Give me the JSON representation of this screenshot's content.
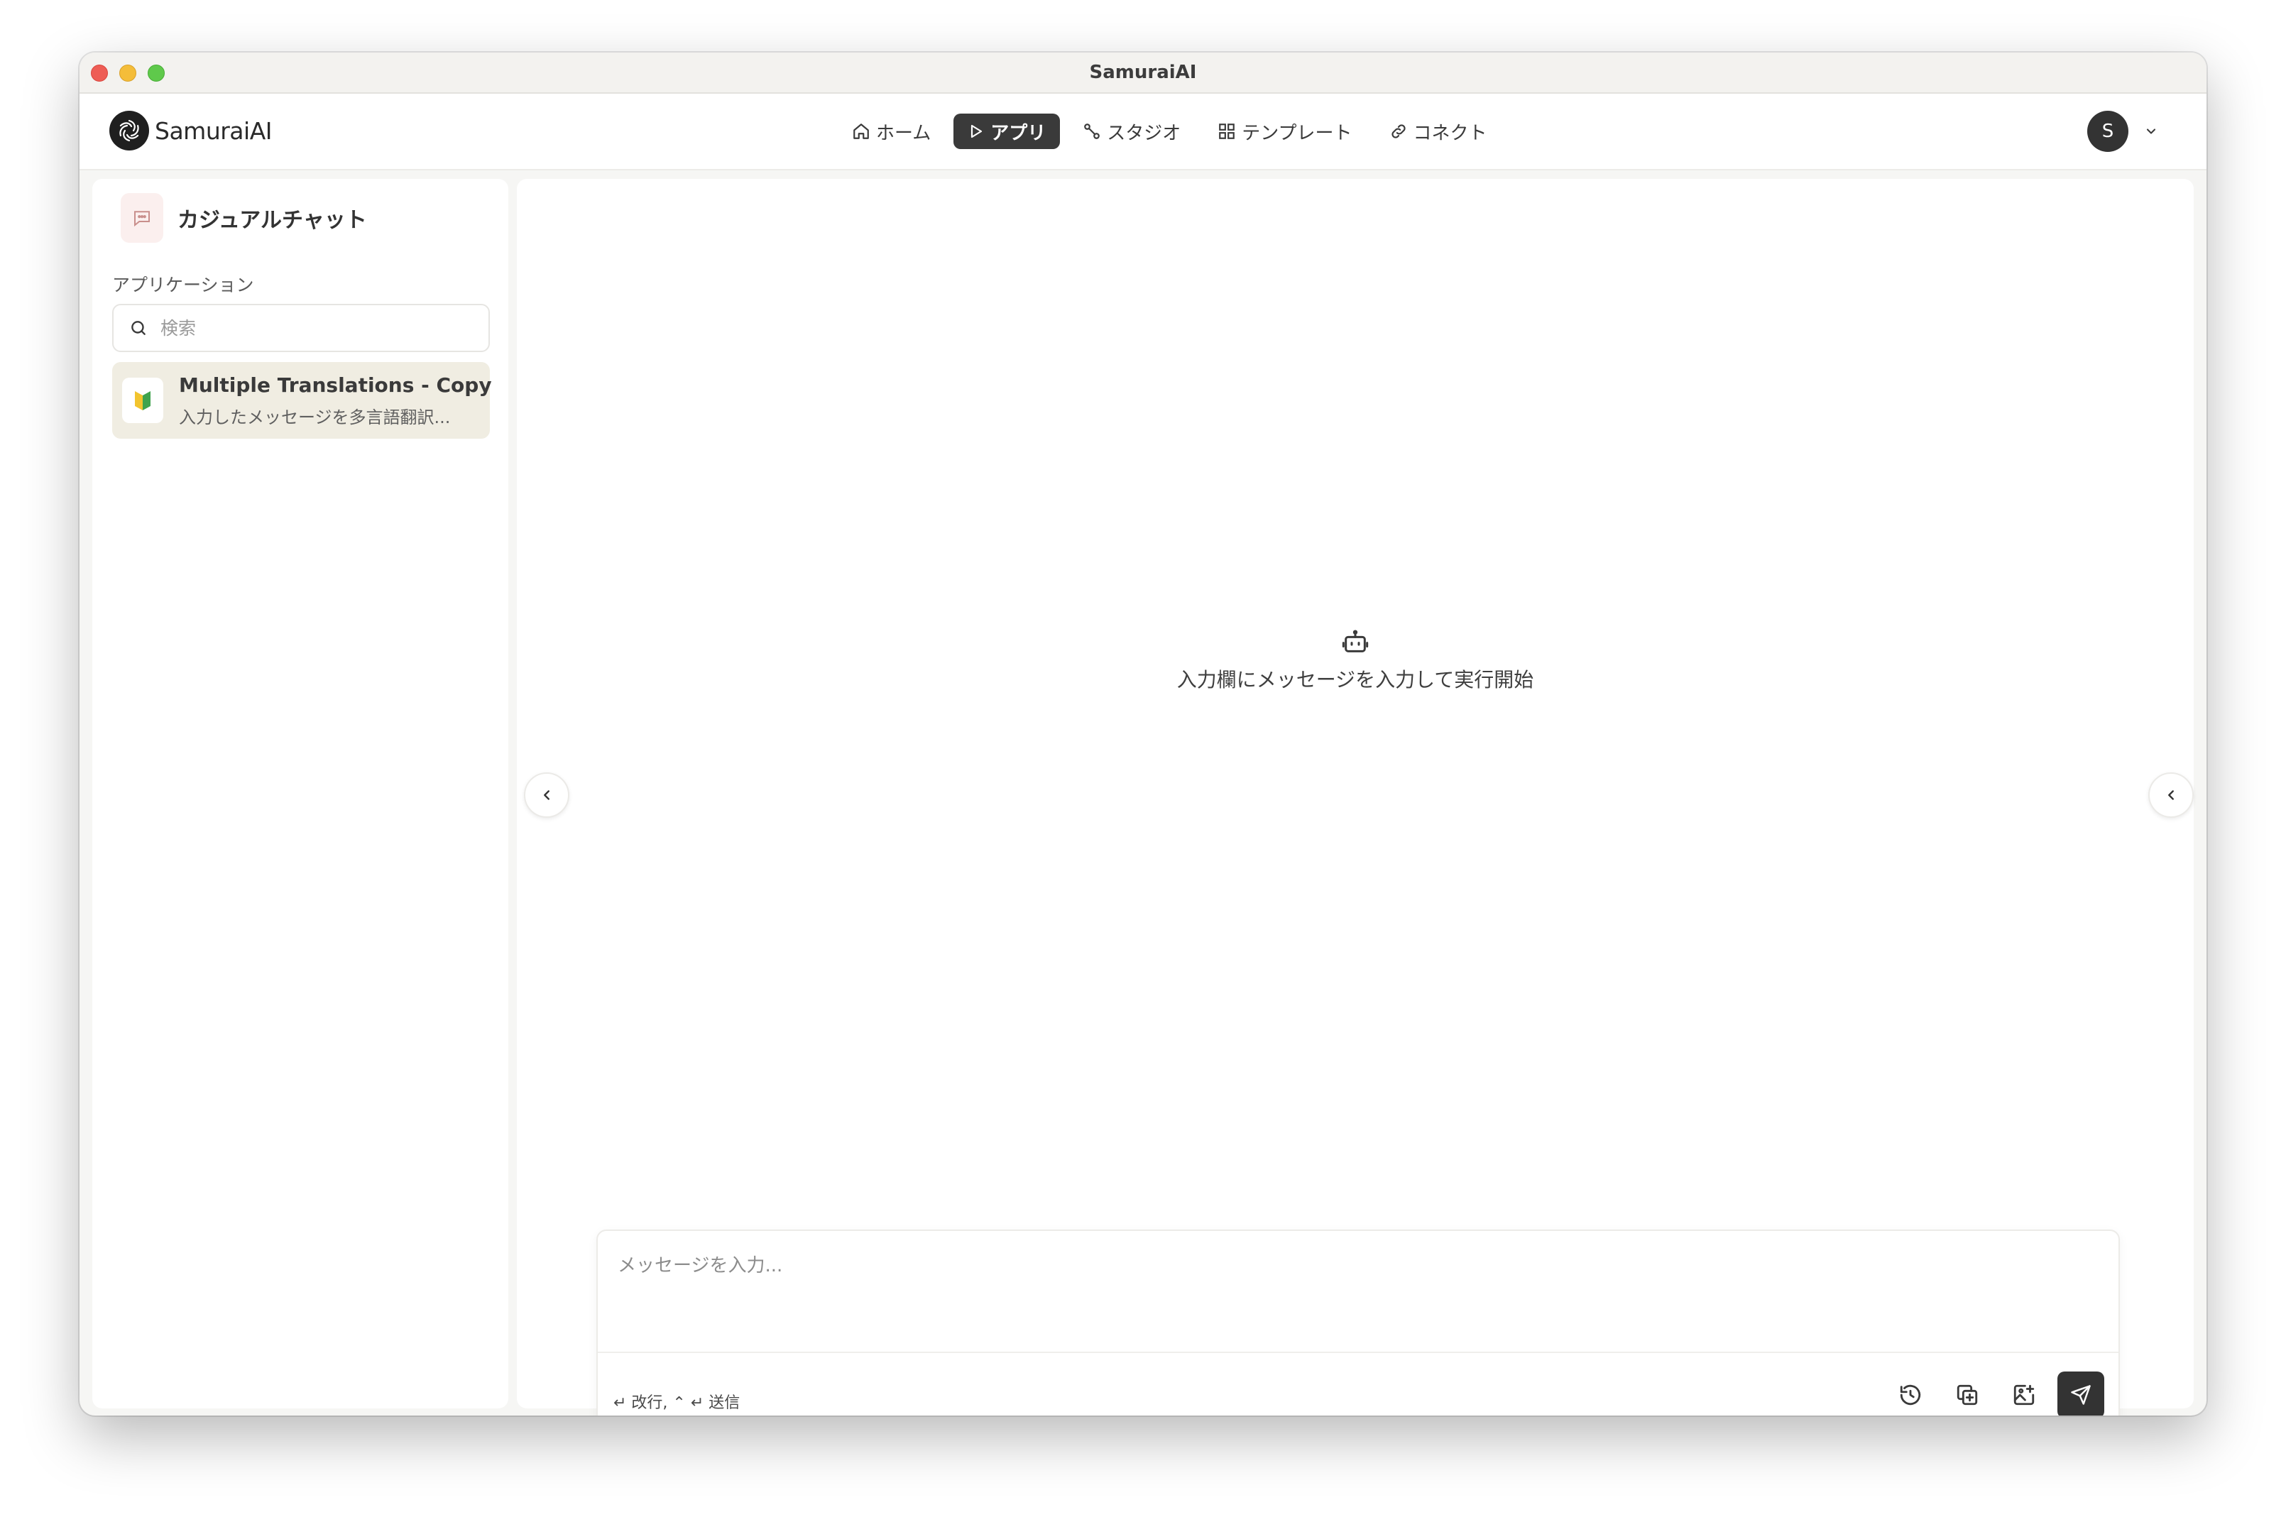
{
  "window": {
    "title": "SamuraiAI"
  },
  "brand": {
    "name": "SamuraiAI"
  },
  "nav": {
    "items": [
      {
        "label": "ホーム",
        "icon": "home-icon",
        "active": false
      },
      {
        "label": "アプリ",
        "icon": "play-icon",
        "active": true
      },
      {
        "label": "スタジオ",
        "icon": "workflow-icon",
        "active": false
      },
      {
        "label": "テンプレート",
        "icon": "template-icon",
        "active": false
      },
      {
        "label": "コネクト",
        "icon": "link-icon",
        "active": false
      }
    ]
  },
  "user": {
    "initial": "S"
  },
  "sidebar": {
    "title": "カジュアルチャット",
    "section_label": "アプリケーション",
    "search": {
      "placeholder": "検索",
      "value": ""
    },
    "apps": [
      {
        "name": "Multiple Translations - Copy",
        "description": "入力したメッセージを多言語翻訳...",
        "icon": "beginner-mark-icon"
      }
    ]
  },
  "main": {
    "empty_state": {
      "text": "入力欄にメッセージを入力して実行開始",
      "icon": "robot-icon"
    },
    "composer": {
      "placeholder": "メッセージを入力...",
      "value": "",
      "hint": "↵ 改行, ⌃ ↵ 送信"
    }
  },
  "colors": {
    "accent": "#333333",
    "active_item_bg": "#f0ede2",
    "window_bg": "#f6f6f4"
  }
}
